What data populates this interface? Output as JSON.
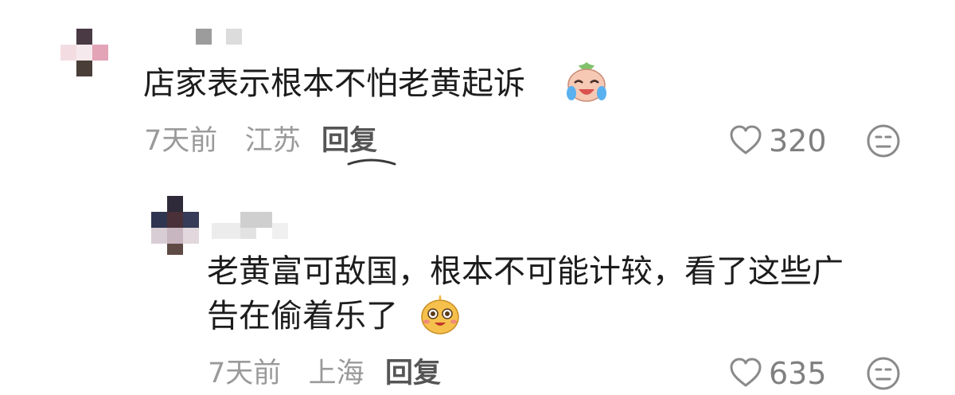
{
  "comments": [
    {
      "text": "店家表示根本不怕老黄起诉",
      "emoji": "crying-laughing-face-icon",
      "time": "7天前",
      "location": "江苏",
      "reply_label": "回复",
      "likes": "320",
      "dislike_icon": "neutral-face-icon"
    },
    {
      "text_line1": "老黄富可敌国，根本不可能计较，看了这些广",
      "text_line2": "告在偷着乐了",
      "emoji": "grinning-face-icon",
      "time": "7天前",
      "location": "上海",
      "reply_label": "回复",
      "likes": "635",
      "dislike_icon": "neutral-face-icon"
    }
  ]
}
